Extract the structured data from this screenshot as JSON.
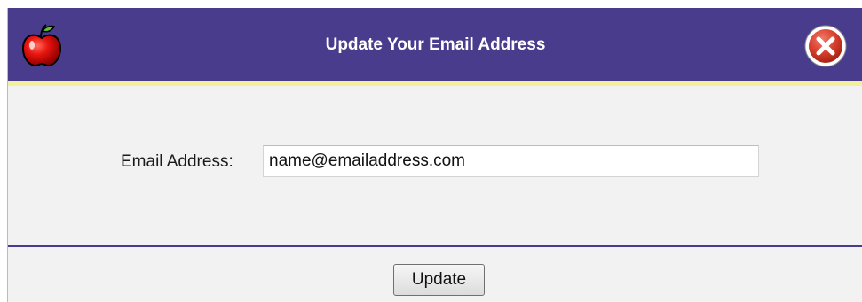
{
  "dialog": {
    "title": "Update Your Email Address",
    "logo_icon": "apple-icon",
    "close_icon": "close-icon"
  },
  "form": {
    "email_label": "Email Address:",
    "email_value": "name@emailaddress.com"
  },
  "footer": {
    "update_label": "Update"
  },
  "colors": {
    "title_bar": "#4a3c8c",
    "title_accent": "#f2f09a",
    "body_background": "#f2f2f2",
    "close_button": "#d9412f"
  }
}
